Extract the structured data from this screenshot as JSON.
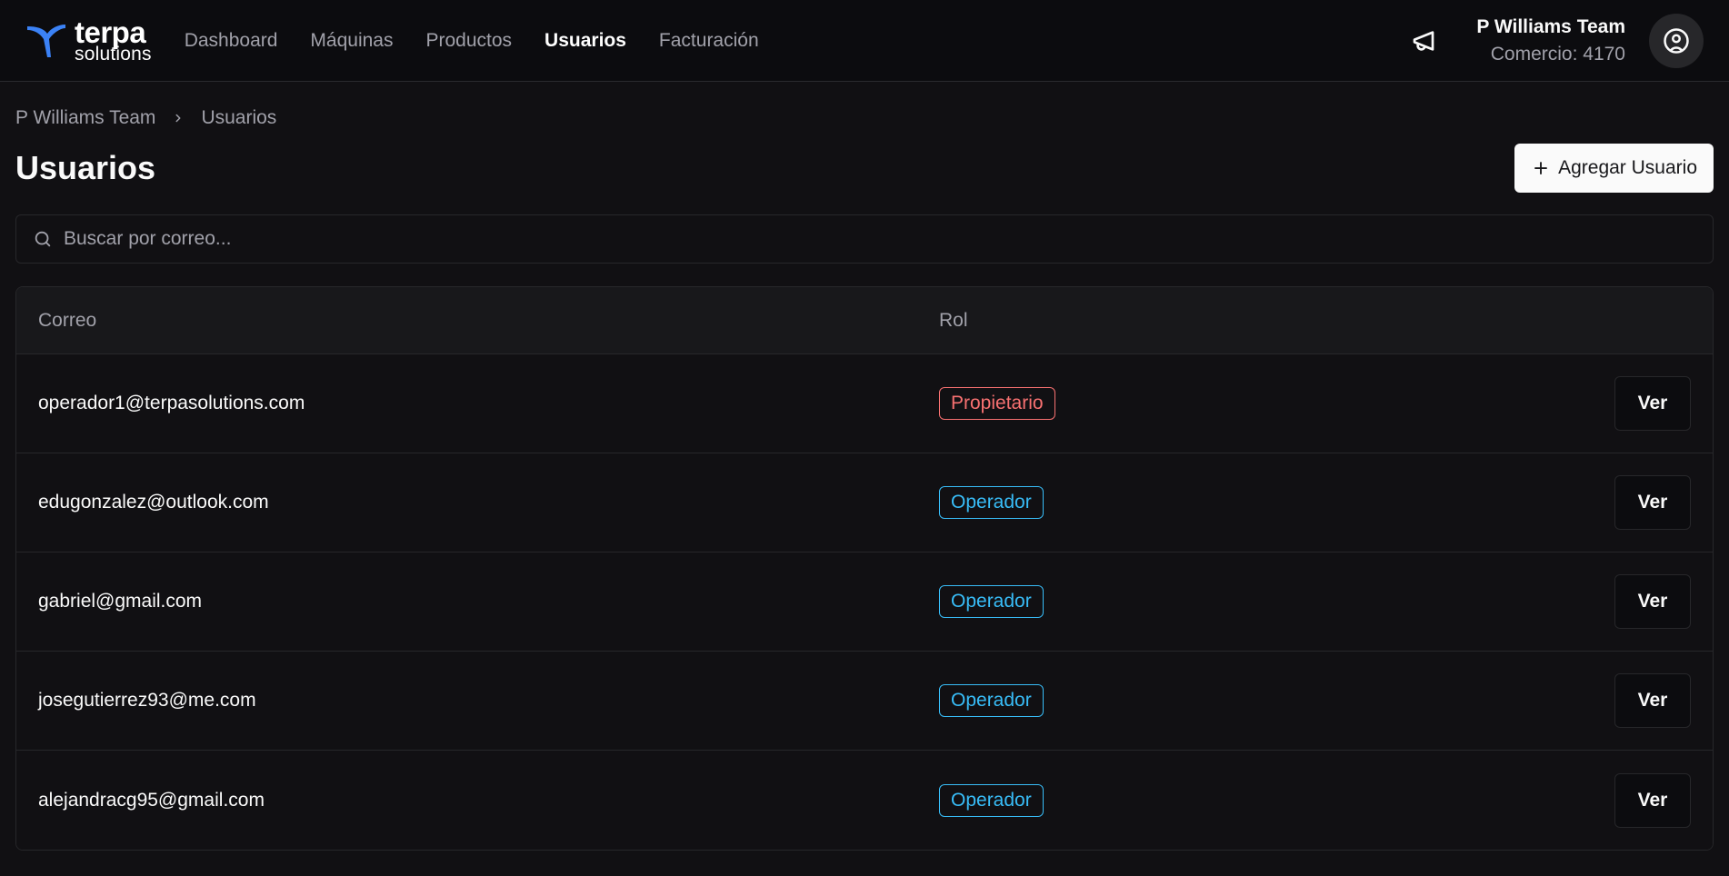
{
  "brand": {
    "word": "terpa",
    "sub": "solutions",
    "accent": "#3b82f6"
  },
  "nav": {
    "items": [
      {
        "label": "Dashboard",
        "active": false
      },
      {
        "label": "Máquinas",
        "active": false
      },
      {
        "label": "Productos",
        "active": false
      },
      {
        "label": "Usuarios",
        "active": true
      },
      {
        "label": "Facturación",
        "active": false
      }
    ]
  },
  "account": {
    "name": "P Williams Team",
    "merchant": "Comercio: 4170"
  },
  "breadcrumb": {
    "root": "P Williams Team",
    "current": "Usuarios"
  },
  "page": {
    "title": "Usuarios",
    "add_button": "Agregar Usuario"
  },
  "search": {
    "placeholder": "Buscar por correo...",
    "value": ""
  },
  "table": {
    "headers": {
      "email": "Correo",
      "role": "Rol"
    },
    "action_label": "Ver",
    "rows": [
      {
        "email": "operador1@terpasolutions.com",
        "role": "Propietario",
        "role_type": "owner"
      },
      {
        "email": "edugonzalez@outlook.com",
        "role": "Operador",
        "role_type": "operator"
      },
      {
        "email": "gabriel@gmail.com",
        "role": "Operador",
        "role_type": "operator"
      },
      {
        "email": "josegutierrez93@me.com",
        "role": "Operador",
        "role_type": "operator"
      },
      {
        "email": "alejandracg95@gmail.com",
        "role": "Operador",
        "role_type": "operator"
      }
    ]
  },
  "colors": {
    "owner": "#f87171",
    "operator": "#38bdf8",
    "background": "#111013"
  }
}
